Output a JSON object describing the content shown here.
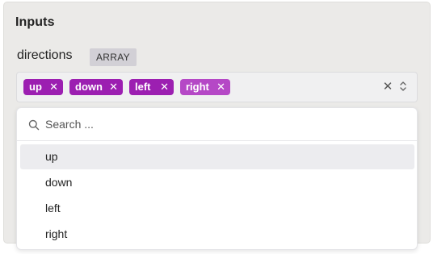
{
  "section": {
    "title": "Inputs"
  },
  "field": {
    "label": "directions",
    "type_badge": "ARRAY"
  },
  "multiselect": {
    "chips": [
      {
        "label": "up",
        "remove": "✕"
      },
      {
        "label": "down",
        "remove": "✕"
      },
      {
        "label": "left",
        "remove": "✕"
      },
      {
        "label": "right",
        "remove": "✕"
      }
    ],
    "clear_icon": "✕",
    "chip_color": "#9c1fb1",
    "chip_color_focused": "#b548c6"
  },
  "dropdown": {
    "search_placeholder": "Search ...",
    "search_value": "",
    "options": [
      {
        "label": "up",
        "highlighted": true
      },
      {
        "label": "down",
        "highlighted": false
      },
      {
        "label": "left",
        "highlighted": false
      },
      {
        "label": "right",
        "highlighted": false
      }
    ]
  },
  "icons": {
    "search": "search-icon",
    "clear": "close-icon",
    "toggle": "chevrons-up-down-icon",
    "chip_remove": "close-icon"
  }
}
